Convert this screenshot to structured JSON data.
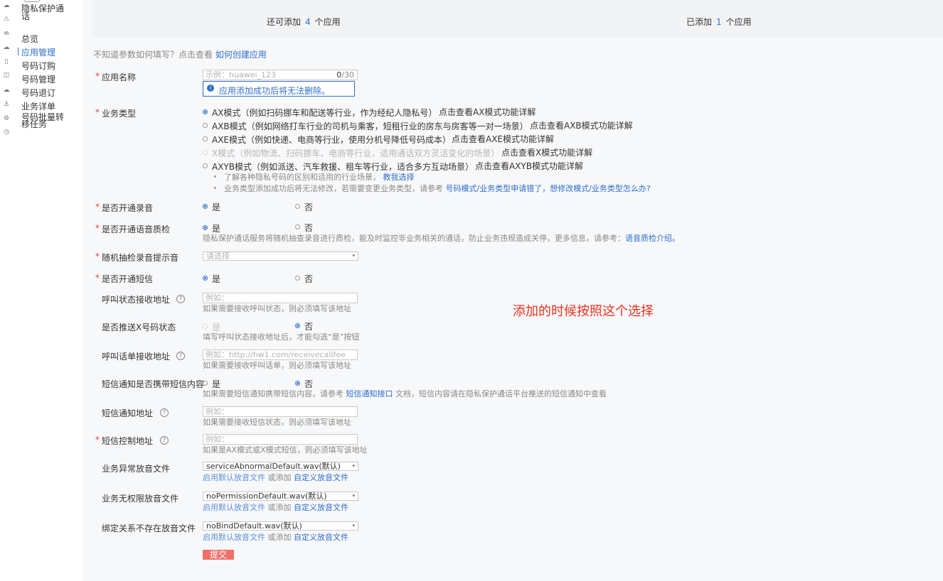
{
  "sidebar": {
    "title": "隐私保护通话",
    "items": [
      {
        "label": "总览",
        "active": false
      },
      {
        "label": "应用管理",
        "active": true
      },
      {
        "label": "号码订购",
        "active": false
      },
      {
        "label": "号码管理",
        "active": false
      },
      {
        "label": "号码退订",
        "active": false
      },
      {
        "label": "业务详单",
        "active": false
      },
      {
        "label": "号码批量转移任务",
        "active": false
      }
    ]
  },
  "stats": {
    "remaining_prefix": "还可添加",
    "remaining_count": "4",
    "remaining_suffix": "个应用",
    "added_prefix": "已添加",
    "added_count": "1",
    "added_suffix": "个应用"
  },
  "help_line": {
    "text": "不知道参数如何填写？点击查看",
    "link": "如何创建应用"
  },
  "form": {
    "app_name": {
      "label": "应用名称",
      "placeholder": "示例：huawei_123",
      "counter_value": "0",
      "counter_max": "/30",
      "info": "应用添加成功后将无法删除。"
    },
    "business_type": {
      "label": "业务类型",
      "options": [
        {
          "text": "AX模式（例如扫码挪车和配送等行业，作为经纪人隐私号）",
          "link": "点击查看AX模式功能详解",
          "selected": true,
          "disabled": false
        },
        {
          "text": "AXB模式（例如网络打车行业的司机与乘客，短租行业的房东与房客等一对一场景）",
          "link": "点击查看AXB模式功能详解",
          "selected": false,
          "disabled": false
        },
        {
          "text": "AXE模式（例如快递、电商等行业，使用分机号降低号码成本）",
          "link": "点击查看AXE模式功能详解",
          "selected": false,
          "disabled": false
        },
        {
          "text": "X模式（例如物流、扫码挪车、电商等行业，适用通话双方灵活变化的场景）",
          "link": "点击查看X模式功能详解",
          "selected": false,
          "disabled": true
        },
        {
          "text": "AXYB模式（例如派送、汽车救援、租车等行业，适合多方互动场景）",
          "link": "点击查看AXYB模式功能详解",
          "selected": false,
          "disabled": false
        }
      ],
      "tip1_text": "了解各种隐私号码的区别和适用的行业场景，",
      "tip1_link": "教我选择",
      "tip2_text": "业务类型添加成功后将无法修改，若需要变更业务类型，请参考",
      "tip2_link": "号码模式/业务类型申请错了，想修改模式/业务类型怎么办?"
    },
    "record": {
      "label": "是否开通录音",
      "yes": "是",
      "no": "否"
    },
    "voice_qc": {
      "label": "是否开通语音质检",
      "yes": "是",
      "no": "否",
      "hint": "隐私保护通话服务将随机抽查录音进行质检，能及时监控非业务相关的通话，防止业务违规造成关停，更多信息，请参考：",
      "hint_link": "语音质检介绍。"
    },
    "sample_tone": {
      "label": "随机抽检录音提示音",
      "placeholder": "请选择"
    },
    "sms": {
      "label": "是否开通短信",
      "yes": "是",
      "no": "否"
    },
    "call_status_url": {
      "label": "呼叫状态接收地址",
      "placeholder": "例如：http://hw1.com/receivecallstatus",
      "hint": "如果需要接收呼叫状态，则必须填写该地址"
    },
    "push_x_status": {
      "label": "是否推送X号码状态",
      "yes": "是",
      "no": "否",
      "hint": "填写呼叫状态接收地址后，才能勾选“是”按钮"
    },
    "call_bill_url": {
      "label": "呼叫话单接收地址",
      "placeholder": "例如：http://hw1.com/receivecallfee",
      "hint": "如果需要接收呼叫话单，则必须填写该地址"
    },
    "sms_content": {
      "label": "短信通知是否携带短信内容",
      "yes": "是",
      "no": "否",
      "hint_prefix": "如果需要短信通知携带短信内容，请参考",
      "hint_link": "短信通知接口",
      "hint_suffix": "文档，短信内容请在隐私保护通话平台推送的短信通知中查看"
    },
    "sms_notify_url": {
      "label": "短信通知地址",
      "placeholder": "例如：http://hw1.com/receivesmsreport",
      "hint": "如果需要接收短信状态，则必须填写该地址"
    },
    "sms_control_url": {
      "label": "短信控制地址",
      "placeholder": "例如：http://hw1.com/receivesmsoperation",
      "hint": "如果是AX模式或X模式短信，则必须填写该地址"
    },
    "abnormal_tone": {
      "label": "业务异常放音文件",
      "value": "serviceAbnormalDefault.wav(默认)"
    },
    "nopermission_tone": {
      "label": "业务无权限放音文件",
      "value": "noPermissionDefault.wav(默认)"
    },
    "nobind_tone": {
      "label": "绑定关系不存在放音文件",
      "value": "noBindDefault.wav(默认)"
    },
    "tone_link_default": "启用默认放音文件",
    "tone_or": "或添加",
    "tone_link_custom": "自定义放音文件",
    "submit": "提交"
  },
  "annotation": "添加的时候按照这个选择",
  "colors": {
    "accent": "#2f6ec9",
    "required": "#e64545",
    "annotation": "#e8321f",
    "submit": "#f0706a"
  }
}
